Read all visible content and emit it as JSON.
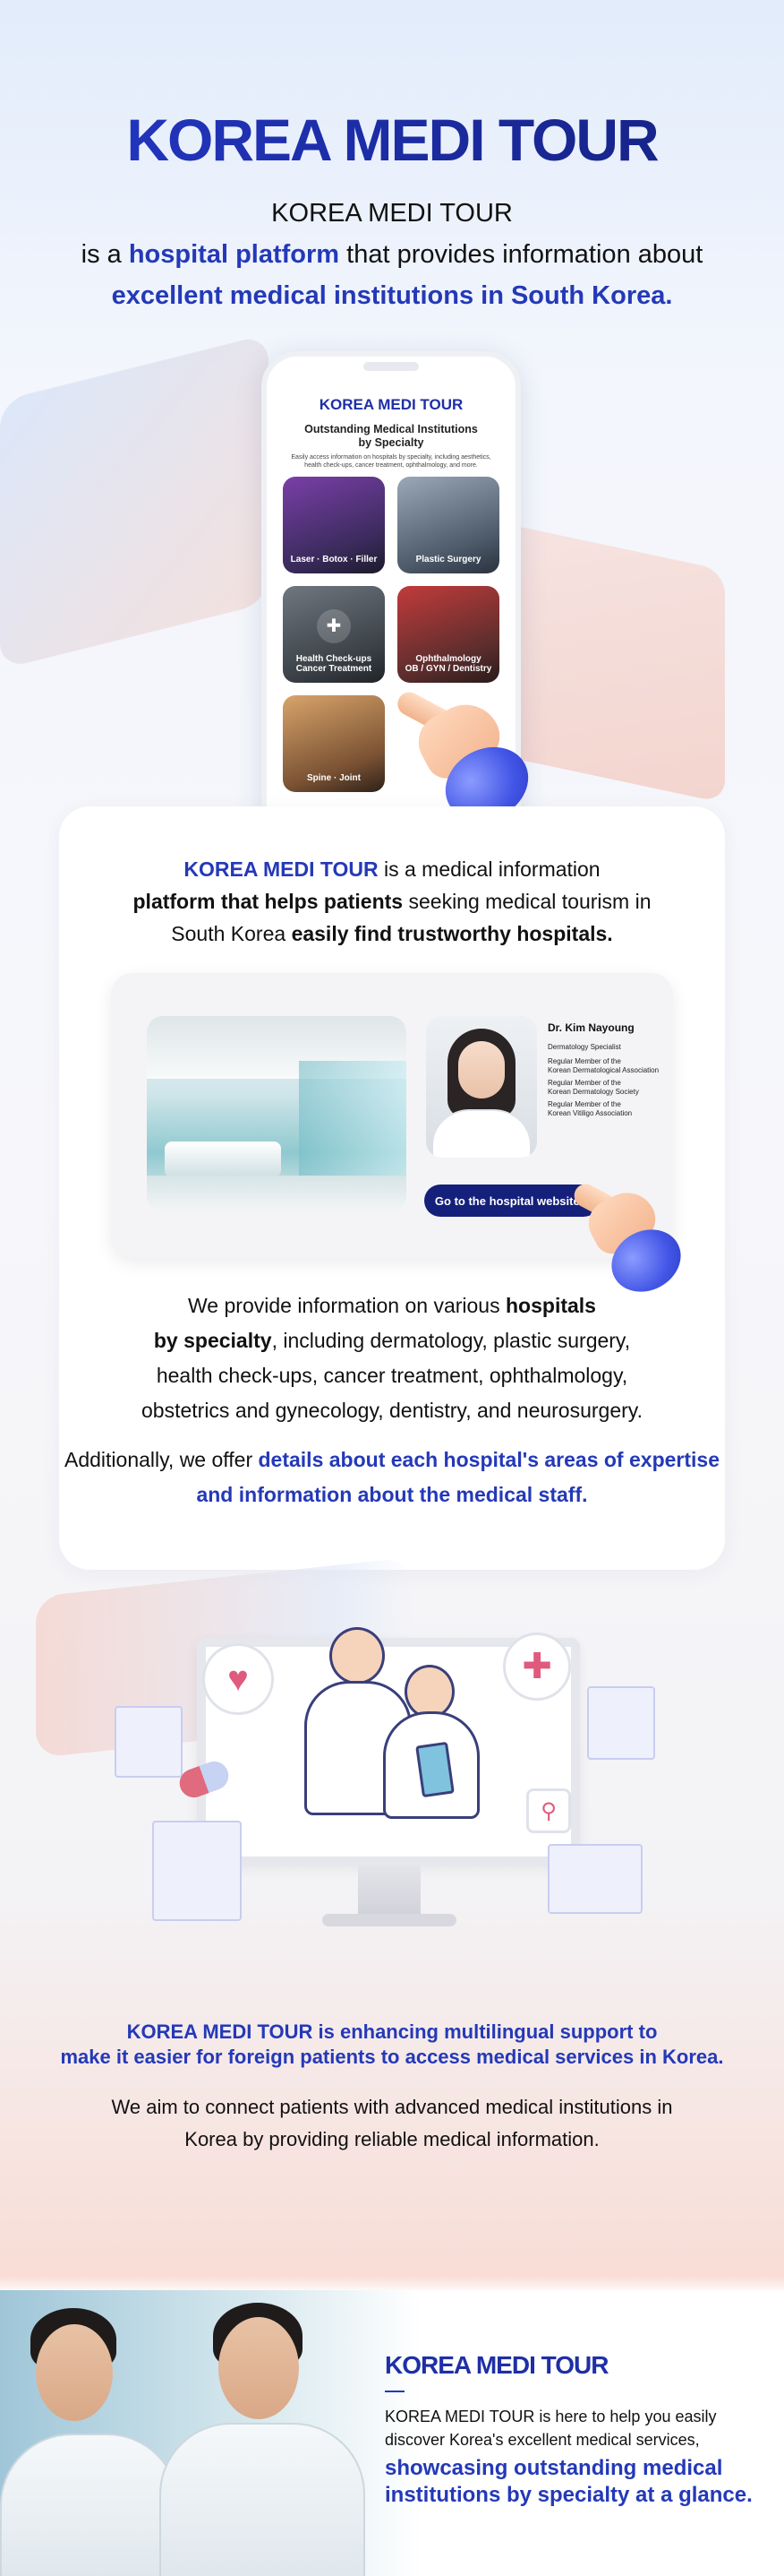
{
  "hero": {
    "brand": "KOREA MEDI TOUR",
    "line1": "KOREA MEDI TOUR",
    "line2_prefix": "is a ",
    "line2_highlight": "hospital platform",
    "line2_suffix": " that provides information about",
    "line3": "excellent medical institutions in South Korea."
  },
  "phone": {
    "brand": "KOREA MEDI TOUR",
    "title_line1": "Outstanding Medical Institutions",
    "title_line2": "by Specialty",
    "description": "Easily access information on hospitals by specialty, including aesthetics, health check-ups, cancer treatment, ophthalmology, and more.",
    "tiles": [
      {
        "label": "Laser · Botox · Filler"
      },
      {
        "label": "Plastic Surgery"
      },
      {
        "label_line1": "Health Check-ups",
        "label_line2": "Cancer Treatment"
      },
      {
        "label_line1": "Ophthalmology",
        "label_line2": "OB / GYN / Dentistry"
      },
      {
        "label": "Spine · Joint"
      }
    ]
  },
  "card": {
    "intro_brand": "KOREA MEDI TOUR",
    "intro_a": " is a medical information",
    "intro_bold": "platform that helps patients",
    "intro_b": " seeking medical tourism in",
    "intro_c": "South Korea ",
    "intro_bold2": "easily find trustworthy hospitals.",
    "doctor": {
      "name": "Dr. Kim Nayoung",
      "specialty": "Dermatology Specialist",
      "membership1_a": "Regular Member of the",
      "membership1_b": "Korean Dermatological Association",
      "membership2_a": "Regular Member of the",
      "membership2_b": "Korean Dermatology Society",
      "membership3_a": "Regular Member of the",
      "membership3_b": "Korean Vitiligo Association"
    },
    "website_button": "Go to the hospital website",
    "p2_a": "We provide information on various ",
    "p2_bold1": "hospitals",
    "p2_bold2": "by specialty",
    "p2_b": ", including dermatology, plastic surgery,",
    "p2_c": "health check-ups, cancer treatment, ophthalmology,",
    "p2_d": "obstetrics and gynecology, dentistry, and neurosurgery.",
    "p3_a": "Additionally, we offer ",
    "p3_hl1": "details about each hospital's areas of expertise",
    "p3_hl2": "and information about the medical staff."
  },
  "illustration": {
    "title_line1": "KOREA MEDI TOUR is enhancing multilingual support to",
    "title_line2": "make it easier for foreign patients to access medical services in Korea.",
    "body_line1": "We aim to connect patients with advanced medical institutions in",
    "body_line2": "Korea by providing reliable medical information."
  },
  "banner": {
    "brand": "KOREA MEDI TOUR",
    "p1_line1": "KOREA MEDI TOUR is here to help you easily",
    "p1_line2": "discover Korea's excellent medical services,",
    "p2_line1": "showcasing outstanding medical",
    "p2_line2": "institutions by specialty at a glance."
  },
  "colors": {
    "brand_blue": "#1f2fa6",
    "highlight_blue": "#2439b8",
    "button_navy": "#14207a",
    "cuff_blue": "#4255e6"
  },
  "icons": [
    "pointing-hand-icon",
    "heart-monitor-icon",
    "medical-cross-icon",
    "magnifier-icon",
    "chevron-right-icon",
    "shield-cross-icon"
  ]
}
